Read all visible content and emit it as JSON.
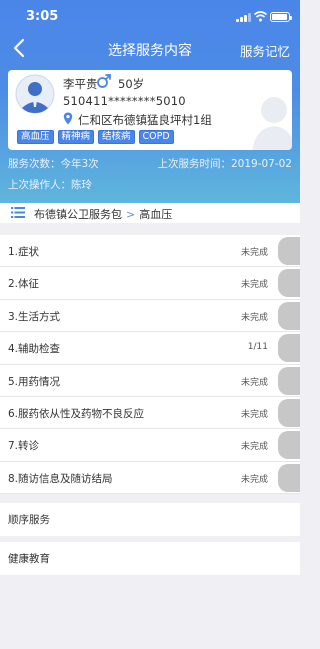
{
  "status_bar": {
    "time": "3:05"
  },
  "nav": {
    "title": "选择服务内容",
    "right_action": "服务记忆"
  },
  "patient": {
    "name": "李平贵",
    "age": "50岁",
    "id_number": "510411********5010",
    "address": "仁和区布德镇猛良坪村1组",
    "tags": [
      "高血压",
      "精神病",
      "结核病",
      "COPD"
    ]
  },
  "stats": {
    "service_count": "服务次数：今年3次",
    "last_service_time": "上次服务时间：2019-07-02",
    "last_operator": "上次操作人：陈玲"
  },
  "breadcrumb": {
    "package": "布德镇公卫服务包",
    "separator": ">",
    "current": "高血压"
  },
  "items": [
    {
      "label": "1.症状",
      "status": "未完成"
    },
    {
      "label": "2.体征",
      "status": "未完成"
    },
    {
      "label": "3.生活方式",
      "status": "未完成"
    },
    {
      "label": "4.辅助检查",
      "status": "1/11"
    },
    {
      "label": "5.用药情况",
      "status": "未完成"
    },
    {
      "label": "6.服药依从性及药物不良反应",
      "status": "未完成"
    },
    {
      "label": "7.转诊",
      "status": "未完成"
    },
    {
      "label": "8.随访信息及随访结局",
      "status": "未完成"
    }
  ],
  "sections": {
    "sequential_service": "顺序服务",
    "health_education": "健康教育"
  },
  "colors": {
    "header_blue": "#4a86e8",
    "header_cyan": "#5fb6dc",
    "tag_blue": "#4a86e8",
    "male_icon": "#4a86e8",
    "tab_gray": "#c7c7c7"
  },
  "icons": [
    "back-chevron-icon",
    "avatar-icon",
    "male-icon",
    "location-pin-icon",
    "list-icon",
    "silhouette-placeholder-icon"
  ]
}
